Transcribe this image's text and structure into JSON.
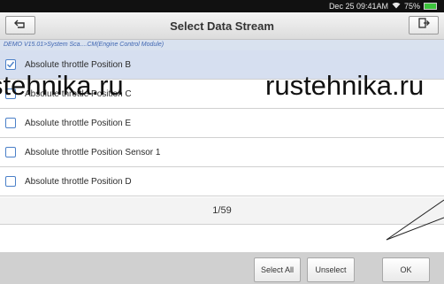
{
  "status_bar": {
    "time": "Dec 25 09:41AM",
    "wifi_icon": "wifi-icon",
    "battery_text": "75%",
    "battery_color": "#3cc43c"
  },
  "header": {
    "title": "Select Data Stream",
    "back_icon": "back-icon",
    "exit_icon": "exit-icon"
  },
  "breadcrumb": "DEMO V15.01>System Sca....CM(Engine Control Module)",
  "items": [
    {
      "label": "Absolute throttle Position B",
      "checked": true
    },
    {
      "label": "Absolute throttle Position C",
      "checked": false
    },
    {
      "label": "Absolute throttle Position E",
      "checked": false
    },
    {
      "label": "Absolute throttle Position Sensor 1",
      "checked": false
    },
    {
      "label": "Absolute throttle Position D",
      "checked": false
    }
  ],
  "page_indicator": "1/59",
  "footer": {
    "select_all": "Select All",
    "unselect": "Unselect",
    "ok": "OK"
  },
  "watermark": {
    "left": "stehnika.ru",
    "right": "rustehnika.ru"
  },
  "colors": {
    "selected_row": "#d6dff0",
    "checkbox_border": "#4b80c8",
    "breadcrumb_text": "#3f66b2"
  }
}
